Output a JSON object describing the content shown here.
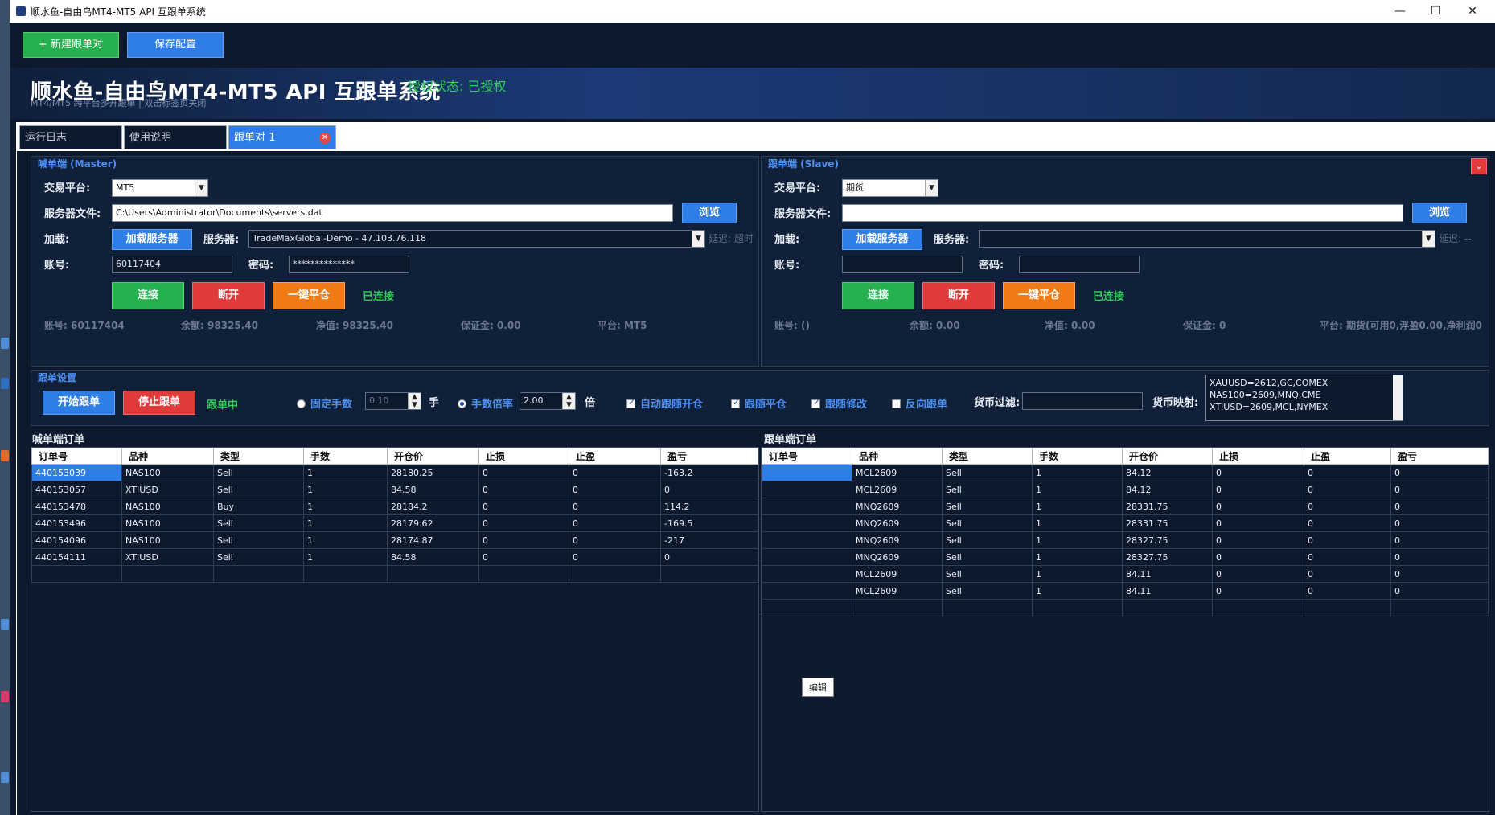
{
  "window": {
    "title": "顺水鱼-自由鸟MT4-MT5 API 互跟单系统",
    "minimize": "—",
    "maximize": "☐",
    "close": "✕"
  },
  "toolbar": {
    "new_pair": "+ 新建跟单对",
    "save_config": "保存配置"
  },
  "banner": {
    "title": "顺水鱼-自由鸟MT4-MT5 API 互跟单系统",
    "auth": "授权状态: 已授权",
    "subtitle": "MT4/MT5 跨平台多开跟单 | 双击标签页关闭"
  },
  "tabs": [
    {
      "label": "运行日志"
    },
    {
      "label": "使用说明"
    },
    {
      "label": "跟单对 1"
    }
  ],
  "master": {
    "title": "喊单端 (Master)",
    "platform_label": "交易平台:",
    "platform": "MT5",
    "server_file_label": "服务器文件:",
    "server_file": "C:\\Users\\Administrator\\Documents\\servers.dat",
    "browse": "浏览",
    "load_label": "加载:",
    "load_btn": "加载服务器",
    "server_label": "服务器:",
    "server": "TradeMaxGlobal-Demo - 47.103.76.118",
    "latency": "延迟: 超时",
    "account_label": "账号:",
    "account": "60117404",
    "password_label": "密码:",
    "password": "**************",
    "connect": "连接",
    "disconnect": "断开",
    "close_all": "一键平仓",
    "status": "已连接",
    "info": {
      "account": "账号: 60117404",
      "balance": "余额: 98325.40",
      "equity": "净值: 98325.40",
      "margin": "保证金: 0.00",
      "platform": "平台: MT5"
    }
  },
  "slave": {
    "title": "跟单端 (Slave)",
    "platform_label": "交易平台:",
    "platform": "期货",
    "server_file_label": "服务器文件:",
    "server_file": "",
    "browse": "浏览",
    "load_label": "加载:",
    "load_btn": "加载服务器",
    "server_label": "服务器:",
    "server": "",
    "latency": "延迟: --",
    "account_label": "账号:",
    "account": "",
    "password_label": "密码:",
    "password": "",
    "connect": "连接",
    "disconnect": "断开",
    "close_all": "一键平仓",
    "status": "已连接",
    "info": {
      "account": "账号: ()",
      "balance": "余额: 0.00",
      "equity": "净值: 0.00",
      "margin": "保证金: 0",
      "platform": "平台: 期货(可用0,浮盈0.00,净利润0"
    }
  },
  "follow": {
    "title": "跟单设置",
    "start": "开始跟单",
    "stop": "停止跟单",
    "status": "跟单中",
    "fixed_lots_label": "固定手数",
    "fixed_lots": "0.10",
    "lots_unit": "手",
    "ratio_label": "手数倍率",
    "ratio": "2.00",
    "ratio_unit": "倍",
    "auto_follow": "自动跟随开仓",
    "follow_close": "跟随平仓",
    "follow_modify": "跟随修改",
    "reverse": "反向跟单",
    "currency_filter_label": "货币过滤:",
    "currency_filter": "",
    "currency_map_label": "货币映射:",
    "currency_map": [
      "XAUUSD=2612,GC,COMEX",
      "NAS100=2609,MNQ,CME",
      "XTIUSD=2609,MCL,NYMEX"
    ]
  },
  "master_orders": {
    "title": "喊单端订单",
    "columns": [
      "订单号",
      "品种",
      "类型",
      "手数",
      "开仓价",
      "止损",
      "止盈",
      "盈亏"
    ],
    "rows": [
      [
        "440153039",
        "NAS100",
        "Sell",
        "1",
        "28180.25",
        "0",
        "0",
        "-163.2"
      ],
      [
        "440153057",
        "XTIUSD",
        "Sell",
        "1",
        "84.58",
        "0",
        "0",
        "0"
      ],
      [
        "440153478",
        "NAS100",
        "Buy",
        "1",
        "28184.2",
        "0",
        "0",
        "114.2"
      ],
      [
        "440153496",
        "NAS100",
        "Sell",
        "1",
        "28179.62",
        "0",
        "0",
        "-169.5"
      ],
      [
        "440154096",
        "NAS100",
        "Sell",
        "1",
        "28174.87",
        "0",
        "0",
        "-217"
      ],
      [
        "440154111",
        "XTIUSD",
        "Sell",
        "1",
        "84.58",
        "0",
        "0",
        "0"
      ]
    ]
  },
  "slave_orders": {
    "title": "跟单端订单",
    "columns": [
      "订单号",
      "品种",
      "类型",
      "手数",
      "开仓价",
      "止损",
      "止盈",
      "盈亏"
    ],
    "rows": [
      [
        "",
        "MCL2609",
        "Sell",
        "1",
        "84.12",
        "0",
        "0",
        "0"
      ],
      [
        "",
        "MCL2609",
        "Sell",
        "1",
        "84.12",
        "0",
        "0",
        "0"
      ],
      [
        "",
        "MNQ2609",
        "Sell",
        "1",
        "28331.75",
        "0",
        "0",
        "0"
      ],
      [
        "",
        "MNQ2609",
        "Sell",
        "1",
        "28331.75",
        "0",
        "0",
        "0"
      ],
      [
        "",
        "MNQ2609",
        "Sell",
        "1",
        "28327.75",
        "0",
        "0",
        "0"
      ],
      [
        "",
        "MNQ2609",
        "Sell",
        "1",
        "28327.75",
        "0",
        "0",
        "0"
      ],
      [
        "",
        "MCL2609",
        "Sell",
        "1",
        "84.11",
        "0",
        "0",
        "0"
      ],
      [
        "",
        "MCL2609",
        "Sell",
        "1",
        "84.11",
        "0",
        "0",
        "0"
      ]
    ],
    "edit_tooltip": "编辑"
  }
}
